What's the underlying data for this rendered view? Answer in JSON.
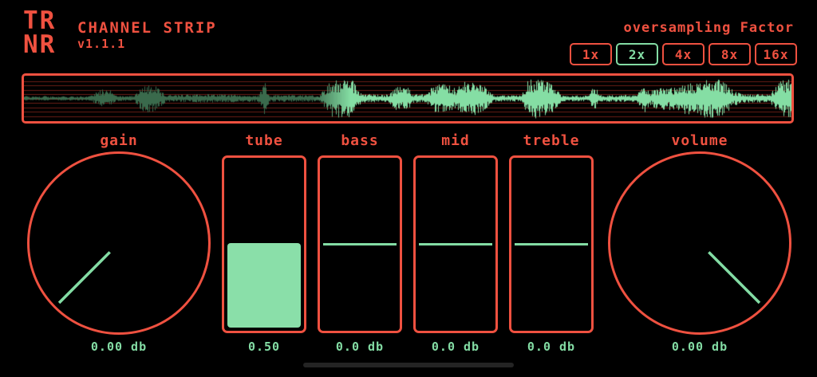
{
  "colors": {
    "accent_red": "#ef5140",
    "accent_green": "#83dca4",
    "fill_green": "#8adfa9",
    "dim_wave_green": "#3a6a4c",
    "grid_red": "#d63c2d",
    "pill_gray": "#242424",
    "background": "#000000"
  },
  "header": {
    "logo_line1": "TR",
    "logo_line2": "NR",
    "title": "CHANNEL STRIP",
    "version": "v1.1.1",
    "oversampling_label": "oversampling Factor",
    "oversampling_options": [
      {
        "label": "1x",
        "selected": false
      },
      {
        "label": "2x",
        "selected": true
      },
      {
        "label": "4x",
        "selected": false
      },
      {
        "label": "8x",
        "selected": false
      },
      {
        "label": "16x",
        "selected": false
      }
    ]
  },
  "waveform": {
    "grid_offsets": [
      0,
      5.5,
      11,
      16.5,
      22
    ],
    "bright_start_fraction": 0.375,
    "envelope": [
      [
        0,
        0.08
      ],
      [
        0.085,
        0.1
      ],
      [
        0.1,
        0.42
      ],
      [
        0.112,
        0.42
      ],
      [
        0.12,
        0.12
      ],
      [
        0.143,
        0.12
      ],
      [
        0.152,
        0.55
      ],
      [
        0.163,
        0.72
      ],
      [
        0.175,
        0.5
      ],
      [
        0.185,
        0.16
      ],
      [
        0.24,
        0.2
      ],
      [
        0.305,
        0.16
      ],
      [
        0.313,
        0.8
      ],
      [
        0.32,
        0.16
      ],
      [
        0.385,
        0.16
      ],
      [
        0.4,
        0.85
      ],
      [
        0.415,
        0.95
      ],
      [
        0.428,
        0.85
      ],
      [
        0.44,
        0.2
      ],
      [
        0.475,
        0.18
      ],
      [
        0.484,
        0.55
      ],
      [
        0.5,
        0.5
      ],
      [
        0.508,
        0.2
      ],
      [
        0.524,
        0.2
      ],
      [
        0.532,
        0.62
      ],
      [
        0.55,
        0.68
      ],
      [
        0.563,
        0.45
      ],
      [
        0.572,
        0.78
      ],
      [
        0.588,
        0.82
      ],
      [
        0.6,
        0.55
      ],
      [
        0.612,
        0.16
      ],
      [
        0.648,
        0.14
      ],
      [
        0.656,
        0.88
      ],
      [
        0.672,
        0.95
      ],
      [
        0.688,
        0.72
      ],
      [
        0.7,
        0.14
      ],
      [
        0.735,
        0.14
      ],
      [
        0.743,
        0.62
      ],
      [
        0.75,
        0.16
      ],
      [
        0.798,
        0.16
      ],
      [
        0.808,
        0.72
      ],
      [
        0.815,
        0.3
      ],
      [
        0.822,
        0.5
      ],
      [
        0.848,
        0.55
      ],
      [
        0.856,
        0.78
      ],
      [
        0.878,
        0.7
      ],
      [
        0.888,
        0.95
      ],
      [
        0.908,
        0.9
      ],
      [
        0.925,
        0.35
      ],
      [
        0.935,
        0.2
      ],
      [
        0.972,
        0.2
      ],
      [
        0.983,
        0.8
      ],
      [
        1,
        0.92
      ]
    ]
  },
  "controls": [
    {
      "id": "gain",
      "type": "knob",
      "label": "gain",
      "value_text": "0.00 db",
      "pointer_angle_deg": 135
    },
    {
      "id": "tube",
      "type": "fill-slider",
      "label": "tube",
      "value_text": "0.50",
      "fill_fraction": 0.49
    },
    {
      "id": "bass",
      "type": "line-slider",
      "label": "bass",
      "value_text": "0.0 db",
      "line_fraction": 0.5
    },
    {
      "id": "mid",
      "type": "line-slider",
      "label": "mid",
      "value_text": "0.0 db",
      "line_fraction": 0.5
    },
    {
      "id": "treble",
      "type": "line-slider",
      "label": "treble",
      "value_text": "0.0 db",
      "line_fraction": 0.5
    },
    {
      "id": "volume",
      "type": "knob",
      "label": "volume",
      "value_text": "0.00 db",
      "pointer_angle_deg": 45
    }
  ]
}
